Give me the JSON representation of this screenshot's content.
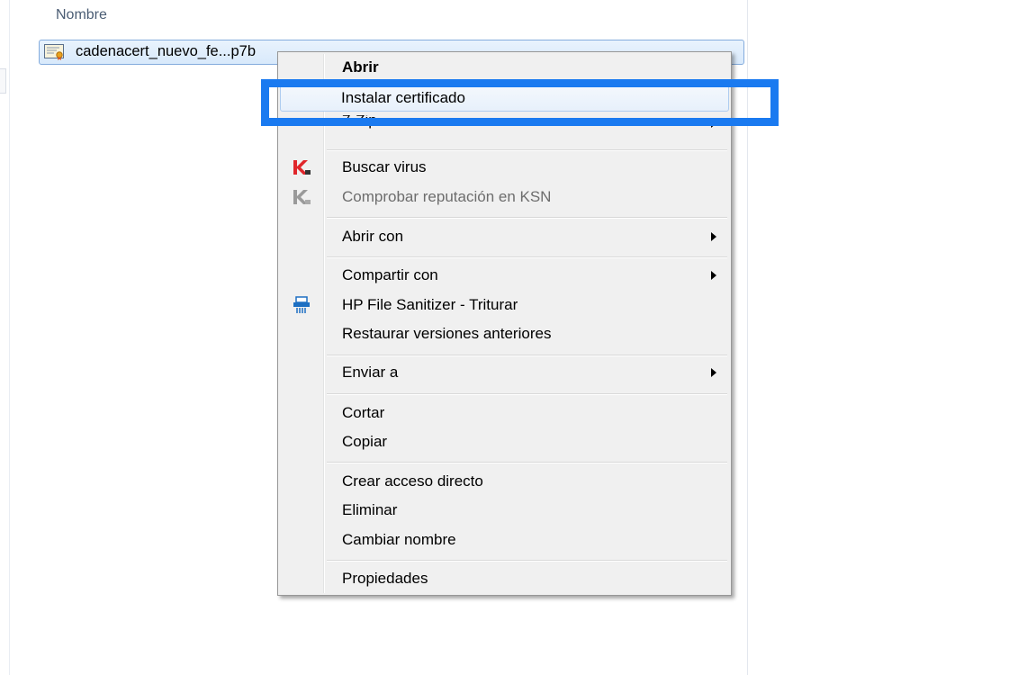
{
  "explorer": {
    "column_header": "Nombre",
    "file_name": "cadenacert_nuevo_fe...p7b"
  },
  "context_menu": {
    "items": {
      "open": "Abrir",
      "install_cert": "Instalar certificado",
      "zip": "7-Zip",
      "scan_virus": "Buscar virus",
      "check_reputation": "Comprobar reputación en KSN",
      "open_with": "Abrir con",
      "share_with": "Compartir con",
      "hp_sanitizer": "HP File Sanitizer - Triturar",
      "restore_versions": "Restaurar versiones anteriores",
      "send_to": "Enviar a",
      "cut": "Cortar",
      "copy": "Copiar",
      "create_shortcut": "Crear acceso directo",
      "delete": "Eliminar",
      "rename": "Cambiar nombre",
      "properties": "Propiedades"
    }
  },
  "colors": {
    "highlight_box": "#1a7af0",
    "kaspersky_red": "#e0262b",
    "hp_blue": "#1d6fc2"
  },
  "icons": {
    "file": "certificate-file-icon",
    "scan_virus": "kaspersky-icon",
    "check_reputation": "kaspersky-gray-icon",
    "hp_sanitizer": "shredder-icon"
  }
}
